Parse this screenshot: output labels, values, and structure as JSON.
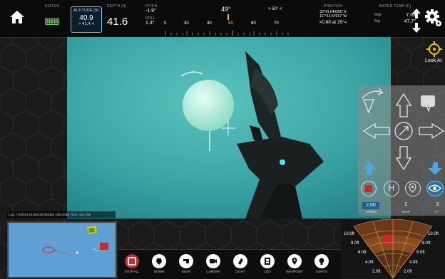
{
  "topbar": {
    "status_label": "STATUS",
    "altitude_label": "ALTITUDE (ft)",
    "altitude_value": "40.9",
    "altitude_limit": "> 41.4 <",
    "depth_label": "DEPTH (ft)",
    "depth_value": "41.6",
    "pitch_label": "PITCH",
    "pitch_value": "-1.9°",
    "roll_label": "ROLL",
    "roll_value": "1.3°",
    "heading_value": "49°",
    "heading_target": "> 50° <",
    "compass_ticks": [
      "0",
      "30",
      "40",
      "50",
      "60",
      "70"
    ],
    "position_label": "POSITION",
    "position_lat": "32°41.046956' N",
    "position_lon": "117°13.57017' W",
    "position_offset": ">0.8ft at 25°<",
    "water_label": "WATER TEMP (C)",
    "rng_label": "Rng",
    "rng_value": "7.0ft",
    "brg_label": "Brg",
    "brg_value": "47.7°"
  },
  "lookat": {
    "label": "Look At"
  },
  "pad": {
    "speed_value": "2.00",
    "speed_label": "SPEED",
    "step_value": "1",
    "step_label": "STEP",
    "third_value": ".5",
    "third_label": "FT"
  },
  "infostrip": "Log: FUSION 20190128 093451 (353.4kB)      Time: 144.75h",
  "toolbar": {
    "items": [
      {
        "label": "STOP ALL"
      },
      {
        "label": "DOWN"
      },
      {
        "label": "GEAR"
      },
      {
        "label": "CAMERA"
      },
      {
        "label": "LIGHT"
      },
      {
        "label": "LOG"
      },
      {
        "label": "WAYPOINT"
      },
      {
        "label": "LIGHTS"
      }
    ]
  },
  "sonar": {
    "left_ranges": [
      "10.0ft",
      "8.0ft",
      "6.0ft",
      "4.0ft",
      "2.0ft"
    ],
    "right_ranges": [
      "10.0ft",
      "8.0ft",
      "6.0ft",
      "4.0ft",
      "2.0ft"
    ]
  },
  "colors": {
    "accent": "#6ac7ff",
    "video_water": "#3aa3a2",
    "battery": "#63c22f",
    "stop": "#d3242a"
  }
}
